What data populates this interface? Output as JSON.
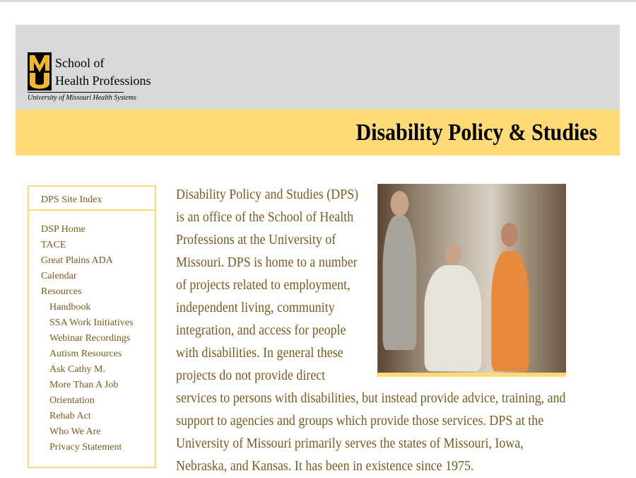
{
  "header": {
    "school_line1": "School of",
    "school_line2": "Health Professions",
    "university": "University of Missouri Health Systems",
    "logo_letters": "MU",
    "site_title": "Disability Policy & Studies"
  },
  "sidebar": {
    "heading": "DPS Site Index",
    "items": [
      {
        "label": "DSP Home"
      },
      {
        "label": "TACE"
      },
      {
        "label": "Great Plains ADA"
      },
      {
        "label": "Calendar"
      },
      {
        "label": "Resources"
      }
    ],
    "subitems": [
      {
        "label": "Handbook"
      },
      {
        "label": "SSA Work Initiatives"
      },
      {
        "label": "Webinar Recordings"
      },
      {
        "label": "Autism Resources"
      },
      {
        "label": "Ask Cathy M."
      },
      {
        "label": "More Than A Job"
      },
      {
        "label": "Orientation"
      },
      {
        "label": "Rehab Act"
      },
      {
        "label": "Who We Are"
      },
      {
        "label": "Privacy Statement"
      }
    ]
  },
  "main": {
    "paragraph": "Disability Policy and Studies (DPS) is an office of the School of Health Professions at the University of Missouri. DPS is home to a number of projects related to employment, independent living, community integration, and access for people with disabilities. In general these projects do not provide direct services to persons with disabilities, but instead provide advice, training, and support to agencies and groups which provide those services. DPS at the University of Missouri primarily serves the states of Missouri, Iowa, Nebraska, and Kansas. It has been in existence since 1975."
  },
  "colors": {
    "header_gray": "#d9d9d9",
    "header_yellow": "#fedb77",
    "link_brown": "#7a5a1e",
    "logo_gold": "#f1b82d"
  }
}
